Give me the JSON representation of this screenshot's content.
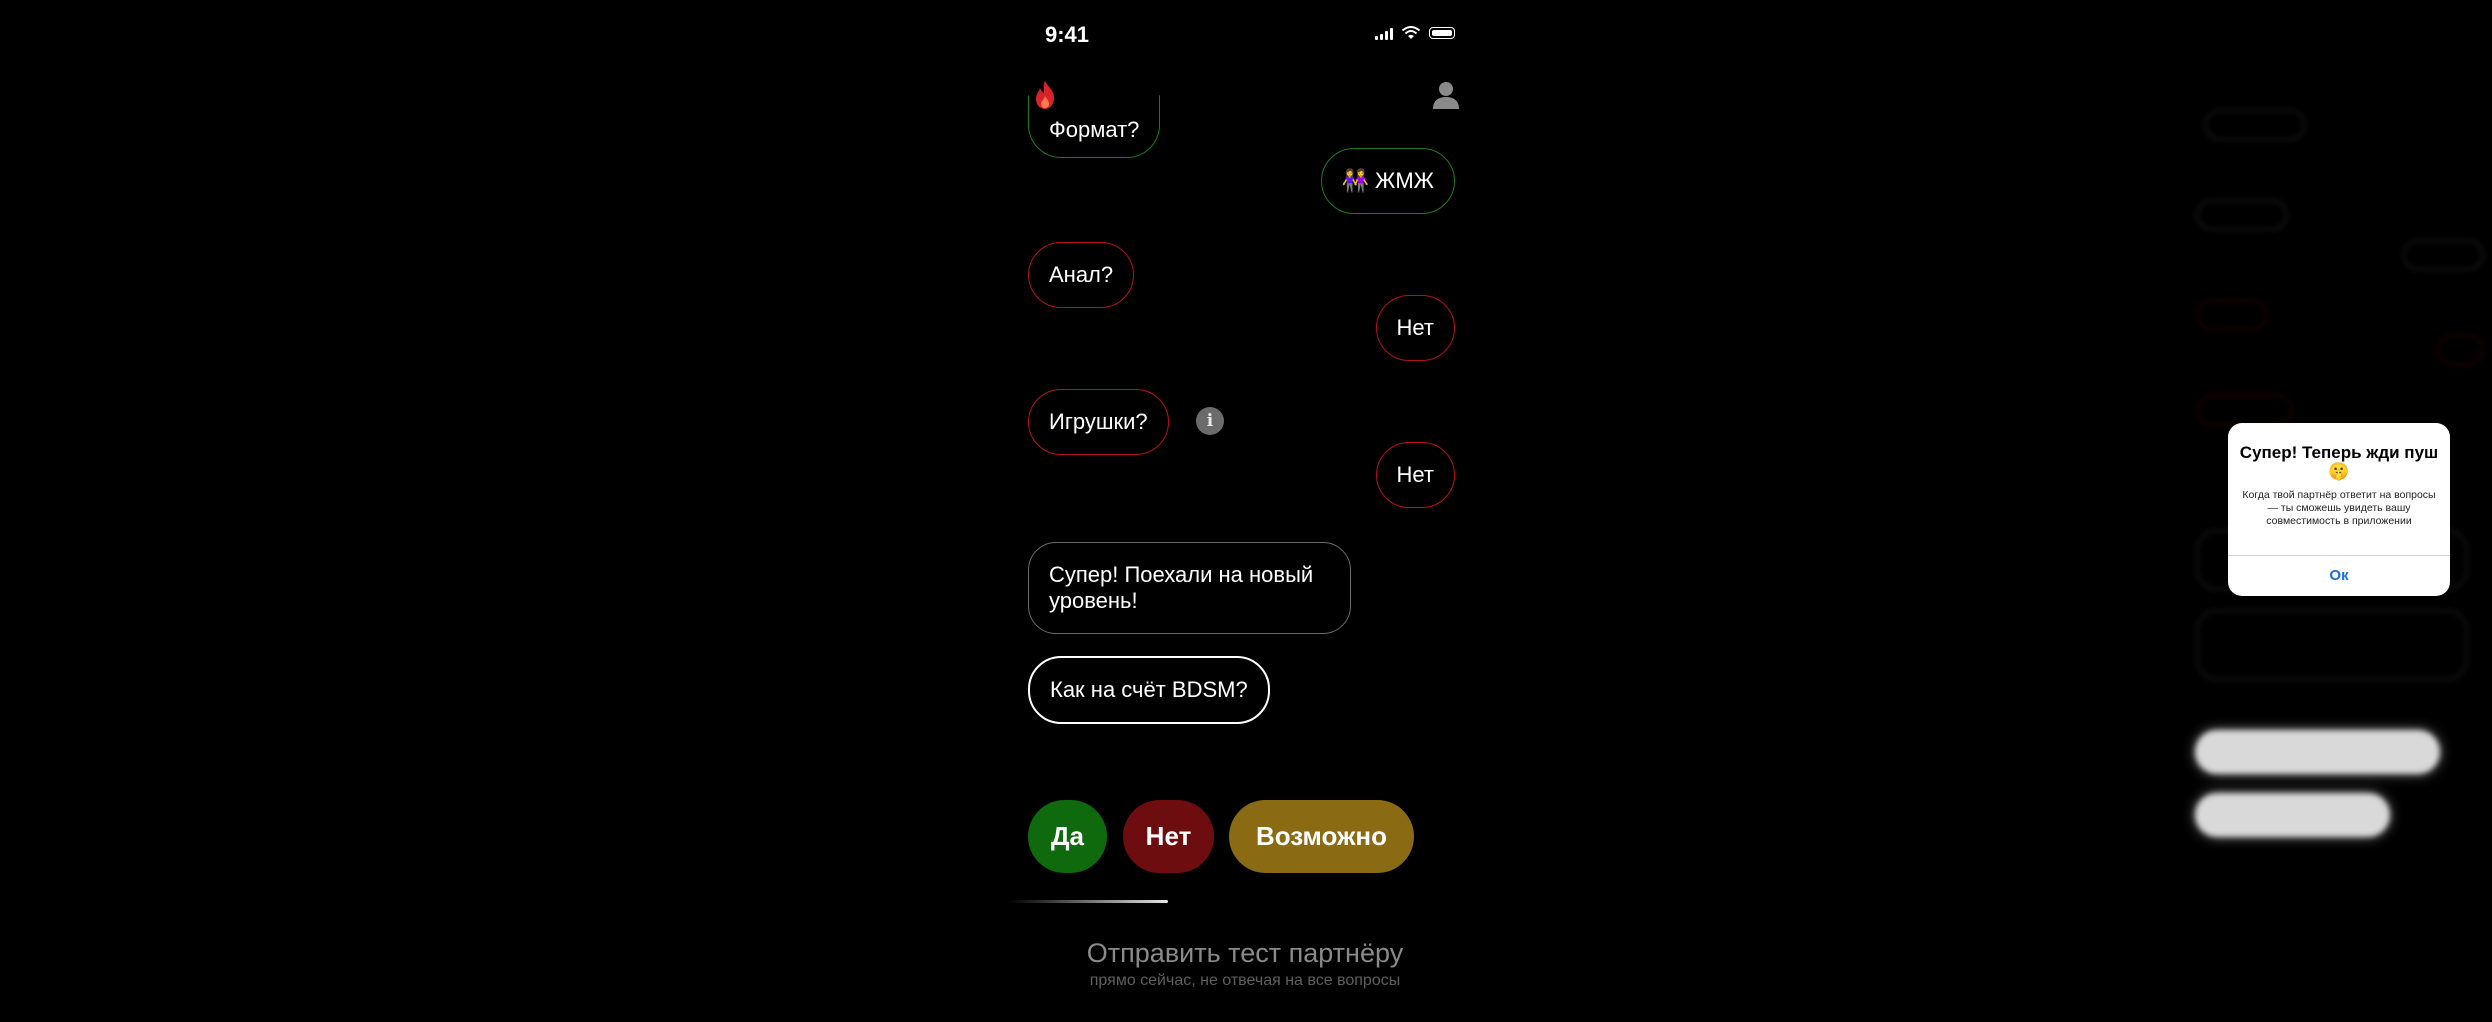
{
  "status_bar": {
    "time": "9:41"
  },
  "header": {
    "flame_icon": "flame-icon",
    "profile_icon": "person-icon"
  },
  "chat": {
    "q_format": "Формат?",
    "a_format": "👭 ЖМЖ",
    "q_anal": "Анал?",
    "a_anal": "Нет",
    "q_toys": "Игрушки?",
    "info_glyph": "i",
    "a_toys": "Нет",
    "msg_super": "Супер! Поехали на новый уровень!",
    "q_bdsm": "Как на счёт BDSM?"
  },
  "answers": {
    "yes": "Да",
    "no": "Нет",
    "maybe": "Возможно"
  },
  "progress": 0.33,
  "send": {
    "title": "Отправить тест партнёру",
    "subtitle": "прямо сейчас, не отвечая на все вопросы"
  },
  "alert": {
    "title": "Супер! Теперь жди пуш 🤫",
    "message": "Когда твой партнёр ответит на вопросы — ты сможешь увидеть вашу совместимость в приложении",
    "ok": "Ок"
  },
  "colors": {
    "yes": "#0f6a0d",
    "no": "#6e0d10",
    "maybe": "#8a6a12",
    "accent_red": "#b3141a",
    "accent_green": "#1f7a1f",
    "ok_blue": "#1a6fe0"
  }
}
